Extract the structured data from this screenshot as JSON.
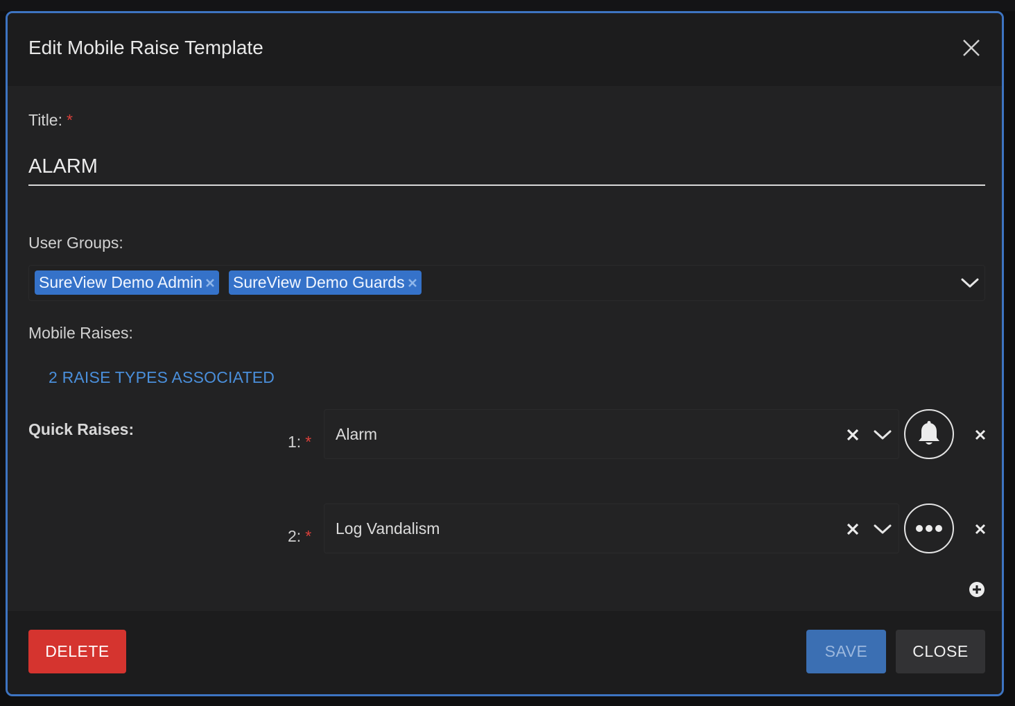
{
  "modal": {
    "title": "Edit Mobile Raise Template"
  },
  "form": {
    "title_label": "Title:",
    "title_required": "*",
    "title_value": "ALARM",
    "user_groups_label": "User Groups:",
    "user_groups": [
      "SureView Demo Admin",
      "SureView Demo Guards"
    ],
    "mobile_raises_label": "Mobile Raises:",
    "mobile_raises_link": "2 RAISE TYPES ASSOCIATED",
    "quick_raises_label": "Quick Raises:",
    "quick_raises": [
      {
        "number": "1:",
        "required": "*",
        "value": "Alarm",
        "icon": "bell-icon"
      },
      {
        "number": "2:",
        "required": "*",
        "value": "Log Vandalism",
        "icon": "more-dots-icon"
      }
    ]
  },
  "footer": {
    "delete_label": "DELETE",
    "save_label": "SAVE",
    "close_label": "CLOSE"
  },
  "colors": {
    "accent": "#3d74c2",
    "chip": "#3572c9",
    "delete": "#d5342f",
    "link": "#4a8fdb",
    "required": "#d9403a"
  }
}
